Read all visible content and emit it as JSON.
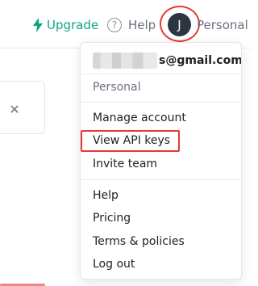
{
  "header": {
    "upgrade_label": "Upgrade",
    "help_label": "Help",
    "avatar_initial": "J",
    "org_label": "Personal"
  },
  "account_menu": {
    "email_suffix": "s@gmail.com",
    "section_label": "Personal",
    "items_group1": [
      "Manage account",
      "View API keys",
      "Invite team"
    ],
    "items_group2": [
      "Help",
      "Pricing",
      "Terms & policies",
      "Log out"
    ],
    "highlighted_item": "View API keys"
  },
  "icons": {
    "upgrade": "lightning-bolt-icon",
    "help": "question-circle-icon",
    "close": "close-icon"
  },
  "colors": {
    "accent": "#10a37f",
    "highlight": "#e53935",
    "avatar_bg": "#2d3540"
  }
}
